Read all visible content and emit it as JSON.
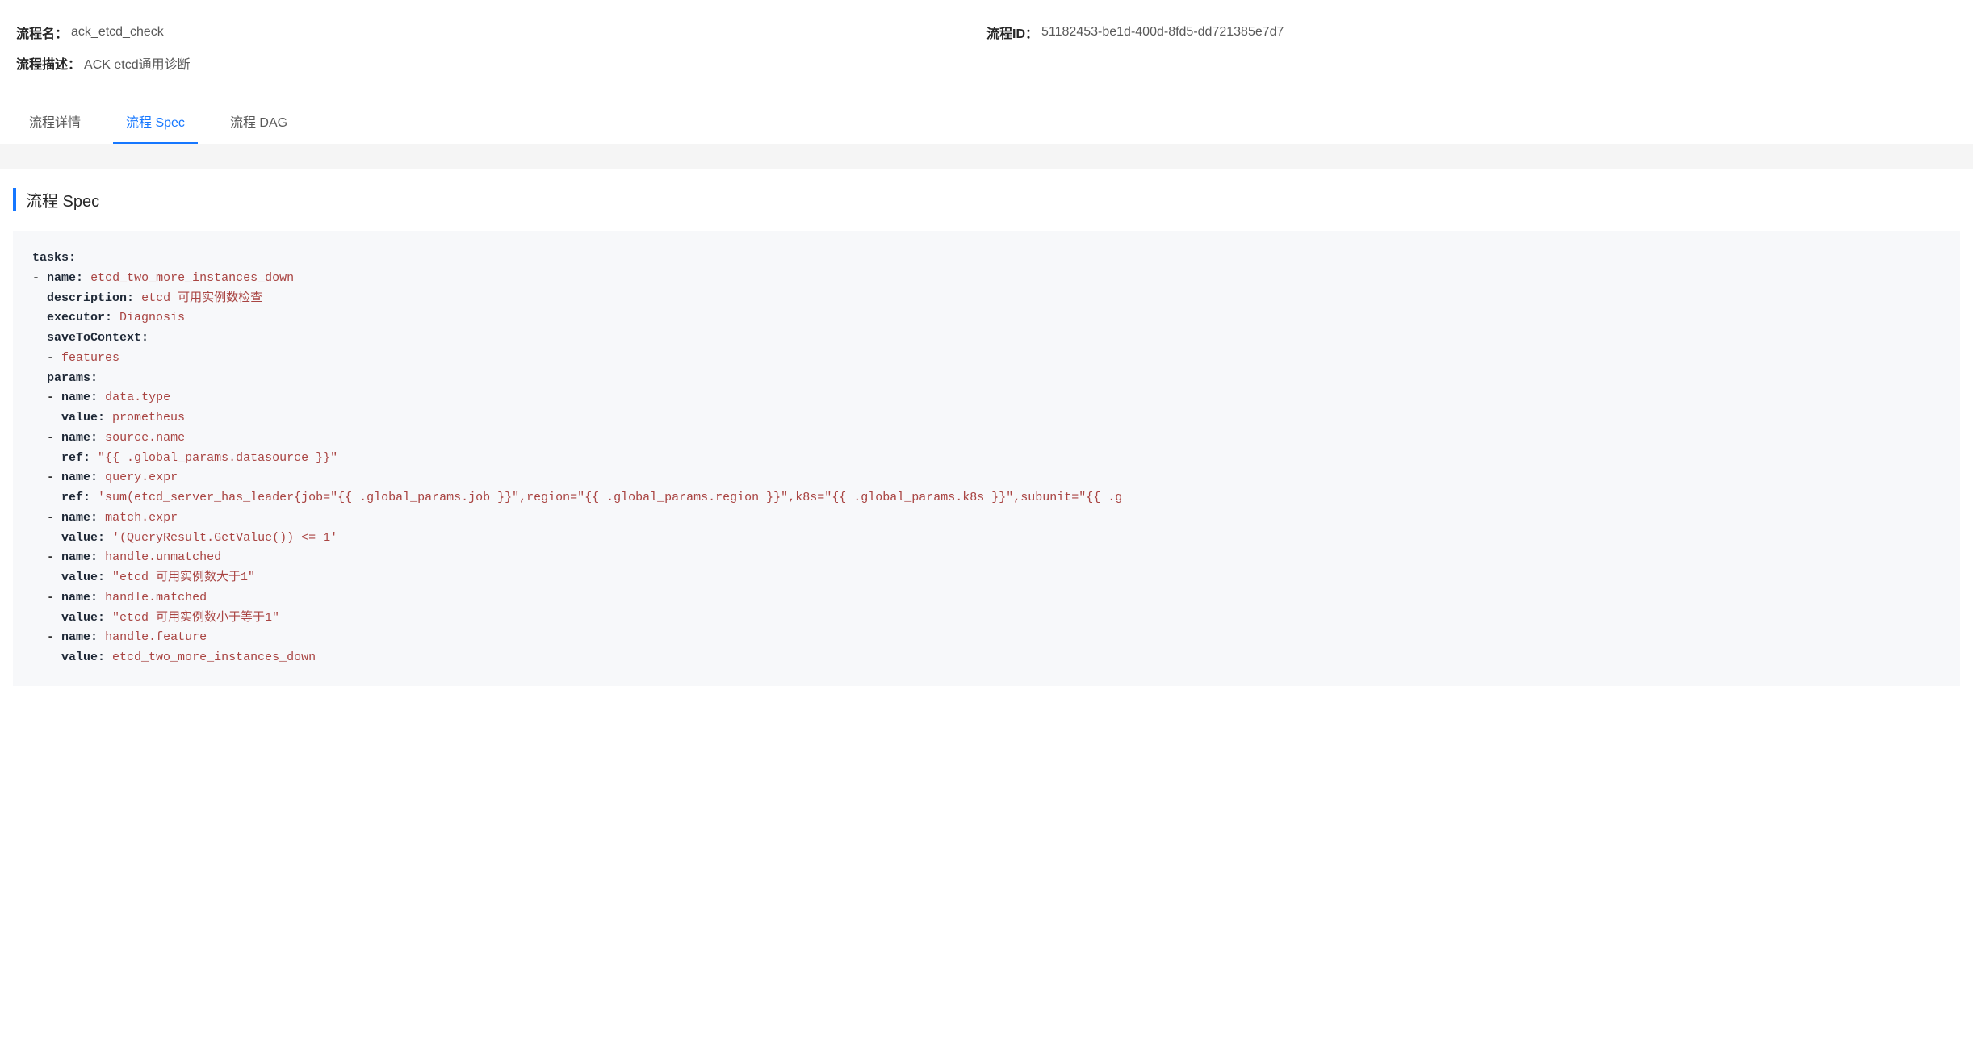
{
  "header": {
    "name_label": "流程名：",
    "name_value": "ack_etcd_check",
    "id_label": "流程ID：",
    "id_value": "51182453-be1d-400d-8fd5-dd721385e7d7",
    "desc_label": "流程描述：",
    "desc_value": "ACK etcd通用诊断"
  },
  "tabs": [
    {
      "label": "流程详情",
      "active": false
    },
    {
      "label": "流程 Spec",
      "active": true
    },
    {
      "label": "流程 DAG",
      "active": false
    }
  ],
  "section_title": "流程 Spec",
  "spec": {
    "tasks_key": "tasks:",
    "task": {
      "name_key": "name:",
      "name_val": "etcd_two_more_instances_down",
      "description_key": "description:",
      "description_val": "etcd 可用实例数检查",
      "executor_key": "executor:",
      "executor_val": "Diagnosis",
      "savetocontext_key": "saveToContext:",
      "savetocontext_item": "features",
      "params_key": "params:",
      "params": [
        {
          "name_key": "name:",
          "name_val": "data.type",
          "v_key": "value:",
          "v_val": "prometheus"
        },
        {
          "name_key": "name:",
          "name_val": "source.name",
          "v_key": "ref:",
          "v_val": "\"{{ .global_params.datasource }}\""
        },
        {
          "name_key": "name:",
          "name_val": "query.expr",
          "v_key": "ref:",
          "v_val": "'sum(etcd_server_has_leader{job=\"{{ .global_params.job }}\",region=\"{{ .global_params.region }}\",k8s=\"{{ .global_params.k8s }}\",subunit=\"{{ .g"
        },
        {
          "name_key": "name:",
          "name_val": "match.expr",
          "v_key": "value:",
          "v_val": "'(QueryResult.GetValue()) <= 1'"
        },
        {
          "name_key": "name:",
          "name_val": "handle.unmatched",
          "v_key": "value:",
          "v_val": "\"etcd 可用实例数大于1\""
        },
        {
          "name_key": "name:",
          "name_val": "handle.matched",
          "v_key": "value:",
          "v_val": "\"etcd 可用实例数小于等于1\""
        },
        {
          "name_key": "name:",
          "name_val": "handle.feature",
          "v_key": "value:",
          "v_val": "etcd_two_more_instances_down"
        }
      ]
    }
  }
}
